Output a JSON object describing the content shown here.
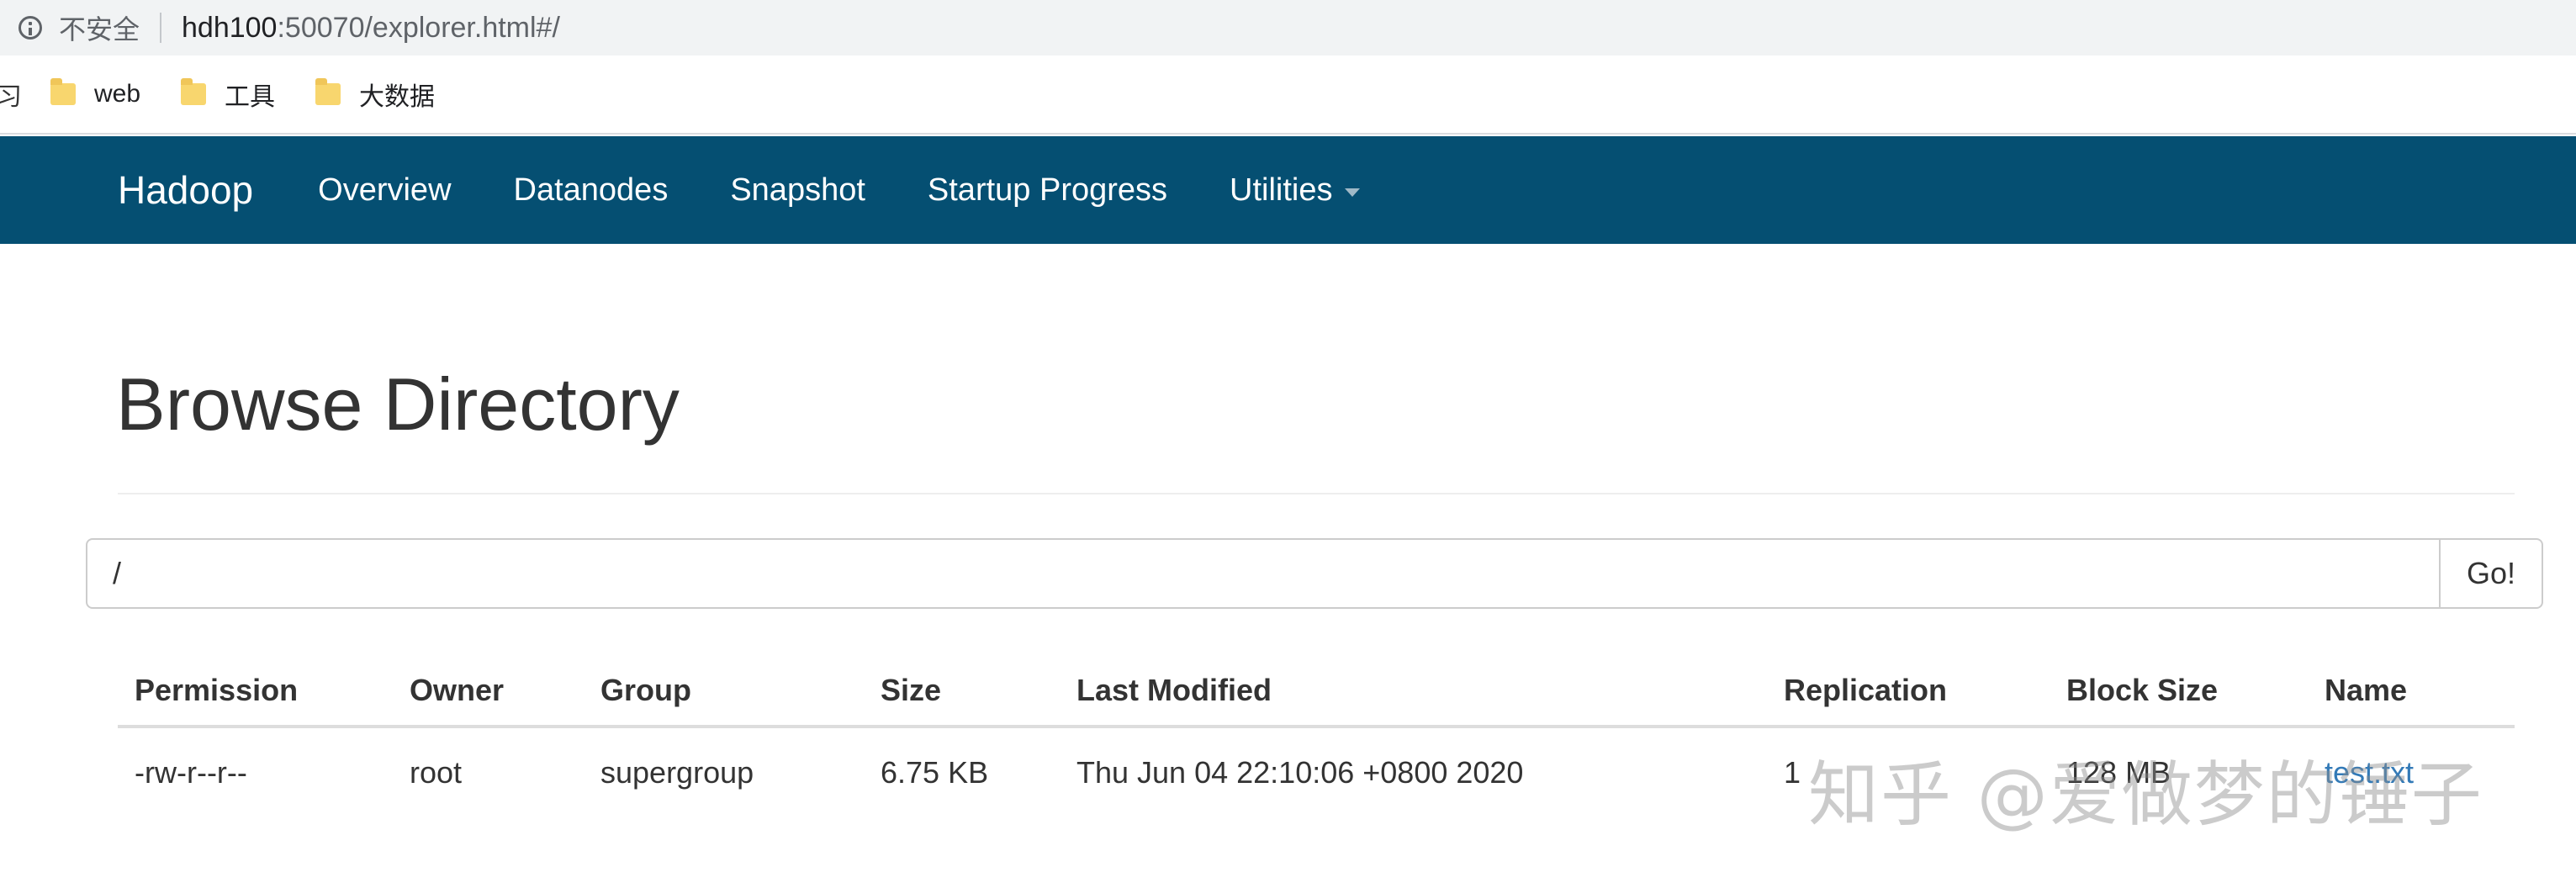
{
  "browser": {
    "security_label": "不安全",
    "url_host": "hdh100",
    "url_rest": ":50070/explorer.html#/"
  },
  "bookmarks": {
    "cut_label": "习",
    "items": [
      {
        "label": "web",
        "icon": "folder-icon"
      },
      {
        "label": "工具",
        "icon": "folder-icon"
      },
      {
        "label": "大数据",
        "icon": "folder-icon"
      }
    ]
  },
  "navbar": {
    "brand": "Hadoop",
    "items": [
      "Overview",
      "Datanodes",
      "Snapshot",
      "Startup Progress",
      "Utilities"
    ],
    "bg_color": "#054f72"
  },
  "page": {
    "title": "Browse Directory",
    "path_value": "/",
    "go_label": "Go!"
  },
  "table": {
    "headers": [
      "Permission",
      "Owner",
      "Group",
      "Size",
      "Last Modified",
      "Replication",
      "Block Size",
      "Name"
    ],
    "rows": [
      {
        "permission": "-rw-r--r--",
        "owner": "root",
        "group": "supergroup",
        "size": "6.75 KB",
        "last_modified": "Thu Jun 04 22:10:06 +0800 2020",
        "replication": "1",
        "block_size": "128 MB",
        "name": "test.txt"
      }
    ]
  },
  "watermark": "知乎 @爱做梦的锤子"
}
